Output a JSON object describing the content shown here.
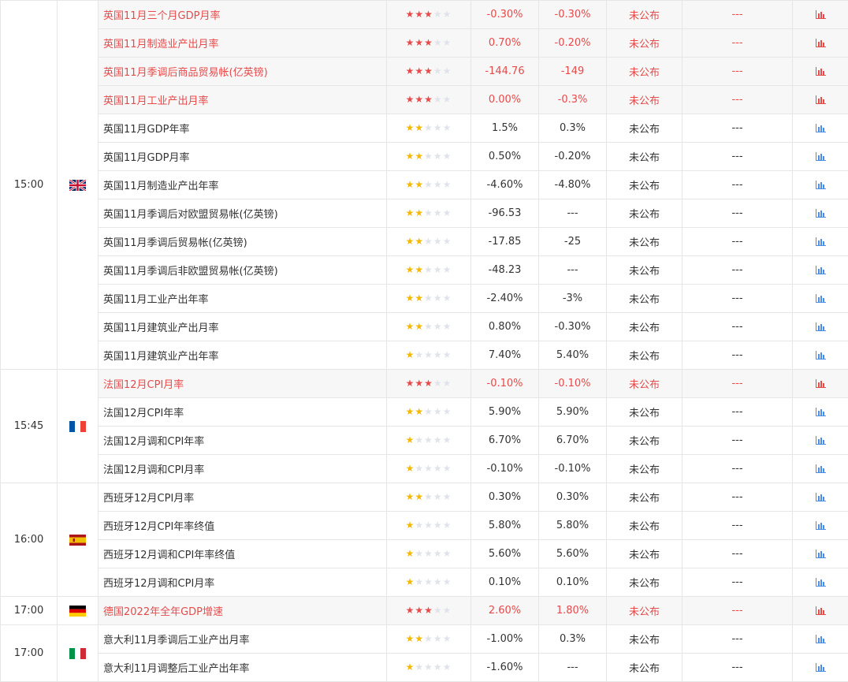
{
  "colors": {
    "highlight_text": "#e84a4a",
    "star_low": "#f5b800",
    "star_empty": "#e0e4ea",
    "chart_blue": "#4a8ee8",
    "chart_red": "#e84a4a"
  },
  "star_max": 5,
  "groups": [
    {
      "time": "15:00",
      "flag": "uk-flag-icon",
      "rows": [
        {
          "name": "英国11月三个月GDP月率",
          "stars": 3,
          "hi": true,
          "prev": "-0.30%",
          "forecast": "-0.30%",
          "actual": "未公布",
          "extra": "---"
        },
        {
          "name": "英国11月制造业产出月率",
          "stars": 3,
          "hi": true,
          "prev": "0.70%",
          "forecast": "-0.20%",
          "actual": "未公布",
          "extra": "---"
        },
        {
          "name": "英国11月季调后商品贸易帐(亿英镑)",
          "stars": 3,
          "hi": true,
          "prev": "-144.76",
          "forecast": "-149",
          "actual": "未公布",
          "extra": "---"
        },
        {
          "name": "英国11月工业产出月率",
          "stars": 3,
          "hi": true,
          "prev": "0.00%",
          "forecast": "-0.3%",
          "actual": "未公布",
          "extra": "---"
        },
        {
          "name": "英国11月GDP年率",
          "stars": 2,
          "hi": false,
          "prev": "1.5%",
          "forecast": "0.3%",
          "actual": "未公布",
          "extra": "---"
        },
        {
          "name": "英国11月GDP月率",
          "stars": 2,
          "hi": false,
          "prev": "0.50%",
          "forecast": "-0.20%",
          "actual": "未公布",
          "extra": "---"
        },
        {
          "name": "英国11月制造业产出年率",
          "stars": 2,
          "hi": false,
          "prev": "-4.60%",
          "forecast": "-4.80%",
          "actual": "未公布",
          "extra": "---"
        },
        {
          "name": "英国11月季调后对欧盟贸易帐(亿英镑)",
          "stars": 2,
          "hi": false,
          "prev": "-96.53",
          "forecast": "---",
          "actual": "未公布",
          "extra": "---"
        },
        {
          "name": "英国11月季调后贸易帐(亿英镑)",
          "stars": 2,
          "hi": false,
          "prev": "-17.85",
          "forecast": "-25",
          "actual": "未公布",
          "extra": "---"
        },
        {
          "name": "英国11月季调后非欧盟贸易帐(亿英镑)",
          "stars": 2,
          "hi": false,
          "prev": "-48.23",
          "forecast": "---",
          "actual": "未公布",
          "extra": "---"
        },
        {
          "name": "英国11月工业产出年率",
          "stars": 2,
          "hi": false,
          "prev": "-2.40%",
          "forecast": "-3%",
          "actual": "未公布",
          "extra": "---"
        },
        {
          "name": "英国11月建筑业产出月率",
          "stars": 2,
          "hi": false,
          "prev": "0.80%",
          "forecast": "-0.30%",
          "actual": "未公布",
          "extra": "---"
        },
        {
          "name": "英国11月建筑业产出年率",
          "stars": 1,
          "hi": false,
          "prev": "7.40%",
          "forecast": "5.40%",
          "actual": "未公布",
          "extra": "---"
        }
      ]
    },
    {
      "time": "15:45",
      "flag": "france-flag-icon",
      "rows": [
        {
          "name": "法国12月CPI月率",
          "stars": 3,
          "hi": true,
          "prev": "-0.10%",
          "forecast": "-0.10%",
          "actual": "未公布",
          "extra": "---"
        },
        {
          "name": "法国12月CPI年率",
          "stars": 2,
          "hi": false,
          "prev": "5.90%",
          "forecast": "5.90%",
          "actual": "未公布",
          "extra": "---"
        },
        {
          "name": "法国12月调和CPI年率",
          "stars": 1,
          "hi": false,
          "prev": "6.70%",
          "forecast": "6.70%",
          "actual": "未公布",
          "extra": "---"
        },
        {
          "name": "法国12月调和CPI月率",
          "stars": 1,
          "hi": false,
          "prev": "-0.10%",
          "forecast": "-0.10%",
          "actual": "未公布",
          "extra": "---"
        }
      ]
    },
    {
      "time": "16:00",
      "flag": "spain-flag-icon",
      "rows": [
        {
          "name": "西班牙12月CPI月率",
          "stars": 2,
          "hi": false,
          "prev": "0.30%",
          "forecast": "0.30%",
          "actual": "未公布",
          "extra": "---"
        },
        {
          "name": "西班牙12月CPI年率终值",
          "stars": 1,
          "hi": false,
          "prev": "5.80%",
          "forecast": "5.80%",
          "actual": "未公布",
          "extra": "---"
        },
        {
          "name": "西班牙12月调和CPI年率终值",
          "stars": 1,
          "hi": false,
          "prev": "5.60%",
          "forecast": "5.60%",
          "actual": "未公布",
          "extra": "---"
        },
        {
          "name": "西班牙12月调和CPI月率",
          "stars": 1,
          "hi": false,
          "prev": "0.10%",
          "forecast": "0.10%",
          "actual": "未公布",
          "extra": "---"
        }
      ]
    },
    {
      "time": "17:00",
      "flag": "germany-flag-icon",
      "rows": [
        {
          "name": "德国2022年全年GDP增速",
          "stars": 3,
          "hi": true,
          "prev": "2.60%",
          "forecast": "1.80%",
          "actual": "未公布",
          "extra": "---"
        }
      ]
    },
    {
      "time": "17:00",
      "flag": "italy-flag-icon",
      "rows": [
        {
          "name": "意大利11月季调后工业产出月率",
          "stars": 2,
          "hi": false,
          "prev": "-1.00%",
          "forecast": "0.3%",
          "actual": "未公布",
          "extra": "---"
        },
        {
          "name": "意大利11月调整后工业产出年率",
          "stars": 1,
          "hi": false,
          "prev": "-1.60%",
          "forecast": "---",
          "actual": "未公布",
          "extra": "---"
        }
      ]
    }
  ]
}
